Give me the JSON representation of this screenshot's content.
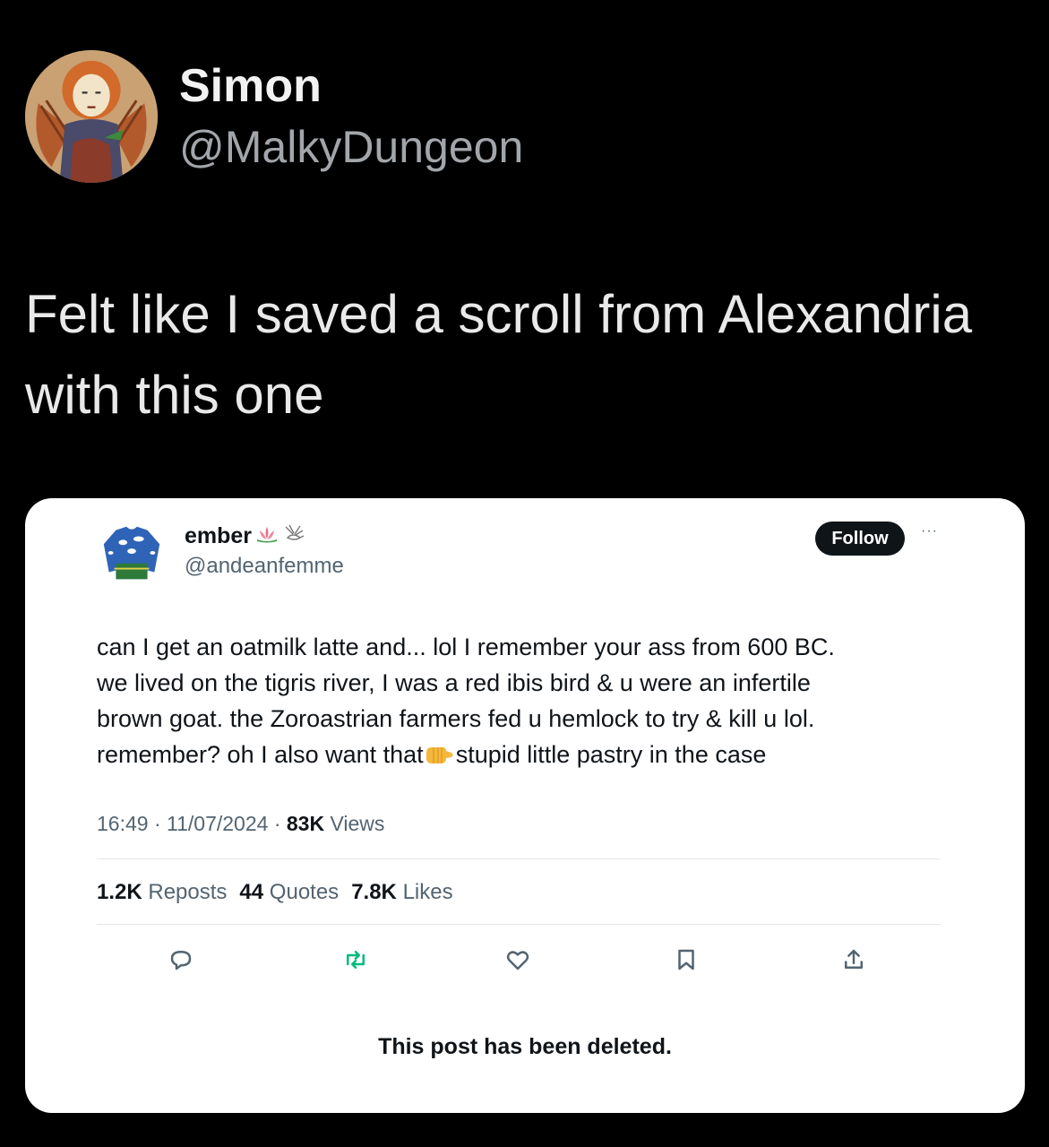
{
  "outer_tweet": {
    "display_name": "Simon",
    "handle": "@MalkyDungeon",
    "text": "Felt like I saved a scroll from Alexandria with this one"
  },
  "quoted_tweet": {
    "display_name": "ember",
    "handle": "@andeanfemme",
    "follow_label": "Follow",
    "more_label": "···",
    "text_lines": [
      "can I get an oatmilk latte and... lol I remember your ass from 600 BC.",
      "we lived on the tigris river, I was a red ibis bird & u were an infertile",
      "brown goat. the Zoroastrian farmers fed u hemlock to try & kill u lol.",
      "remember? oh I also want that",
      "stupid little pastry in the case"
    ],
    "time": "16:49",
    "date": "11/07/2024",
    "views_count": "83K",
    "views_label": "Views",
    "reposts_count": "1.2K",
    "reposts_label": "Reposts",
    "quotes_count": "44",
    "quotes_label": "Quotes",
    "likes_count": "7.8K",
    "likes_label": "Likes",
    "deleted_notice": "This post has been deleted."
  },
  "colors": {
    "background": "#000000",
    "card": "#ffffff",
    "secondary_text": "#536471",
    "repost_green": "#00ba7c"
  },
  "icons": [
    "reply-icon",
    "repost-icon",
    "like-icon",
    "bookmark-icon",
    "share-icon",
    "lotus-emoji-icon",
    "bird-emoji-icon",
    "pointing-hand-emoji-icon"
  ]
}
